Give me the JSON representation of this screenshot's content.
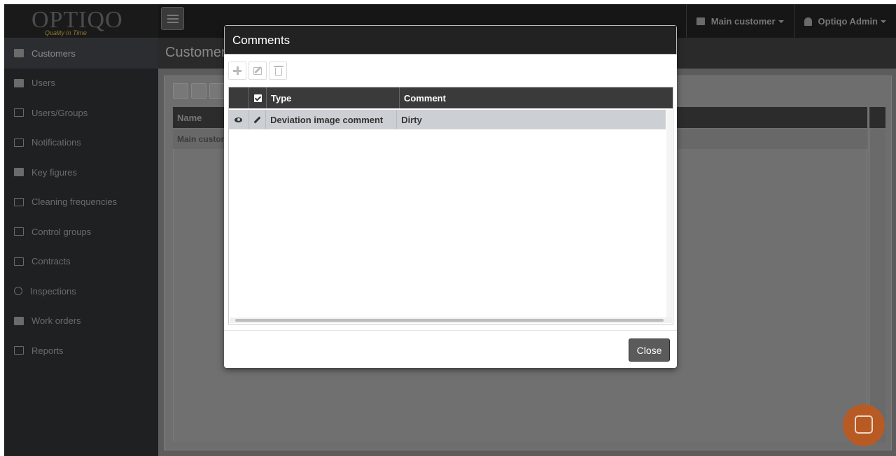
{
  "logo": {
    "text": "OPTIQO",
    "tagline": "Quality in Time"
  },
  "sidebar": {
    "items": [
      {
        "label": "Customers",
        "icon": "briefcase-icon",
        "active": true
      },
      {
        "label": "Users",
        "icon": "users-icon"
      },
      {
        "label": "Users/Groups",
        "icon": "id-card-icon"
      },
      {
        "label": "Notifications",
        "icon": "envelope-icon"
      },
      {
        "label": "Key figures",
        "icon": "book-icon"
      },
      {
        "label": "Cleaning frequencies",
        "icon": "calculator-icon"
      },
      {
        "label": "Control groups",
        "icon": "cubes-icon"
      },
      {
        "label": "Contracts",
        "icon": "building-icon"
      },
      {
        "label": "Inspections",
        "icon": "clock-icon"
      },
      {
        "label": "Work orders",
        "icon": "list-alt-icon"
      },
      {
        "label": "Reports",
        "icon": "monitor-icon"
      }
    ]
  },
  "topbar": {
    "customer_label": "Main customer",
    "user_label": "Optiqo Admin"
  },
  "page": {
    "title": "Customers",
    "grid_header": "Name",
    "grid_row": "Main customer"
  },
  "modal": {
    "title": "Comments",
    "columns": {
      "type": "Type",
      "comment": "Comment"
    },
    "rows": [
      {
        "type": "Deviation image comment",
        "comment": "Dirty"
      }
    ],
    "close_label": "Close"
  },
  "colors": {
    "chat_bubble": "#b85a24",
    "header_dark": "#3a3a3a",
    "selected_row": "#ccd0d4"
  }
}
